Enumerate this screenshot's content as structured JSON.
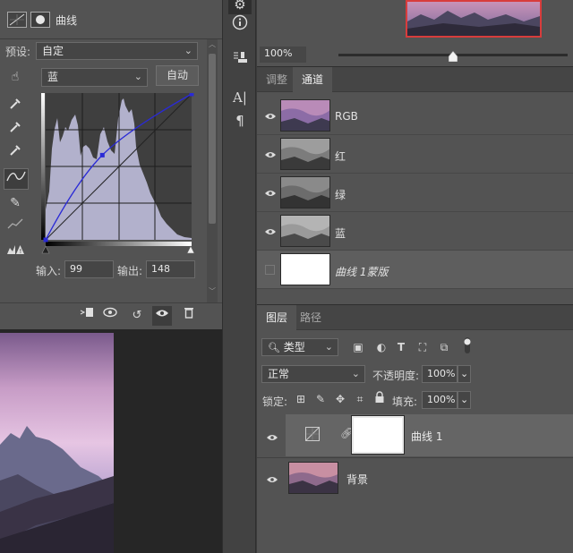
{
  "properties": {
    "panel_title": "曲线",
    "preset_label": "预设:",
    "preset_value": "自定",
    "channel_value": "蓝",
    "auto_label": "自动",
    "input_label": "输入:",
    "input_value": "99",
    "output_label": "输出:",
    "output_value": "148"
  },
  "curve": {
    "control_point": {
      "input": 99,
      "output": 148
    },
    "curve_color": "#2a2ad6"
  },
  "navigator": {
    "zoom": "100%",
    "zoom_slider_fraction": 0.5
  },
  "channels": {
    "tabs": [
      "调整",
      "通道"
    ],
    "active_tab": "通道",
    "rows": [
      {
        "name": "RGB"
      },
      {
        "name": "红"
      },
      {
        "name": "绿"
      },
      {
        "name": "蓝"
      },
      {
        "name": "曲线 1蒙版"
      }
    ]
  },
  "layers": {
    "tabs": [
      "图层",
      "路径"
    ],
    "active_tab": "图层",
    "filter_label": "类型",
    "blend_mode": "正常",
    "opacity_label": "不透明度:",
    "opacity_value": "100%",
    "lock_label": "锁定:",
    "fill_label": "填充:",
    "fill_value": "100%",
    "items": [
      {
        "name": "曲线 1"
      },
      {
        "name": "背景"
      }
    ]
  },
  "colors": {
    "active_layer_bg": "#656565",
    "thumb_border": "#d83c3c",
    "panel_bg": "#535353"
  }
}
